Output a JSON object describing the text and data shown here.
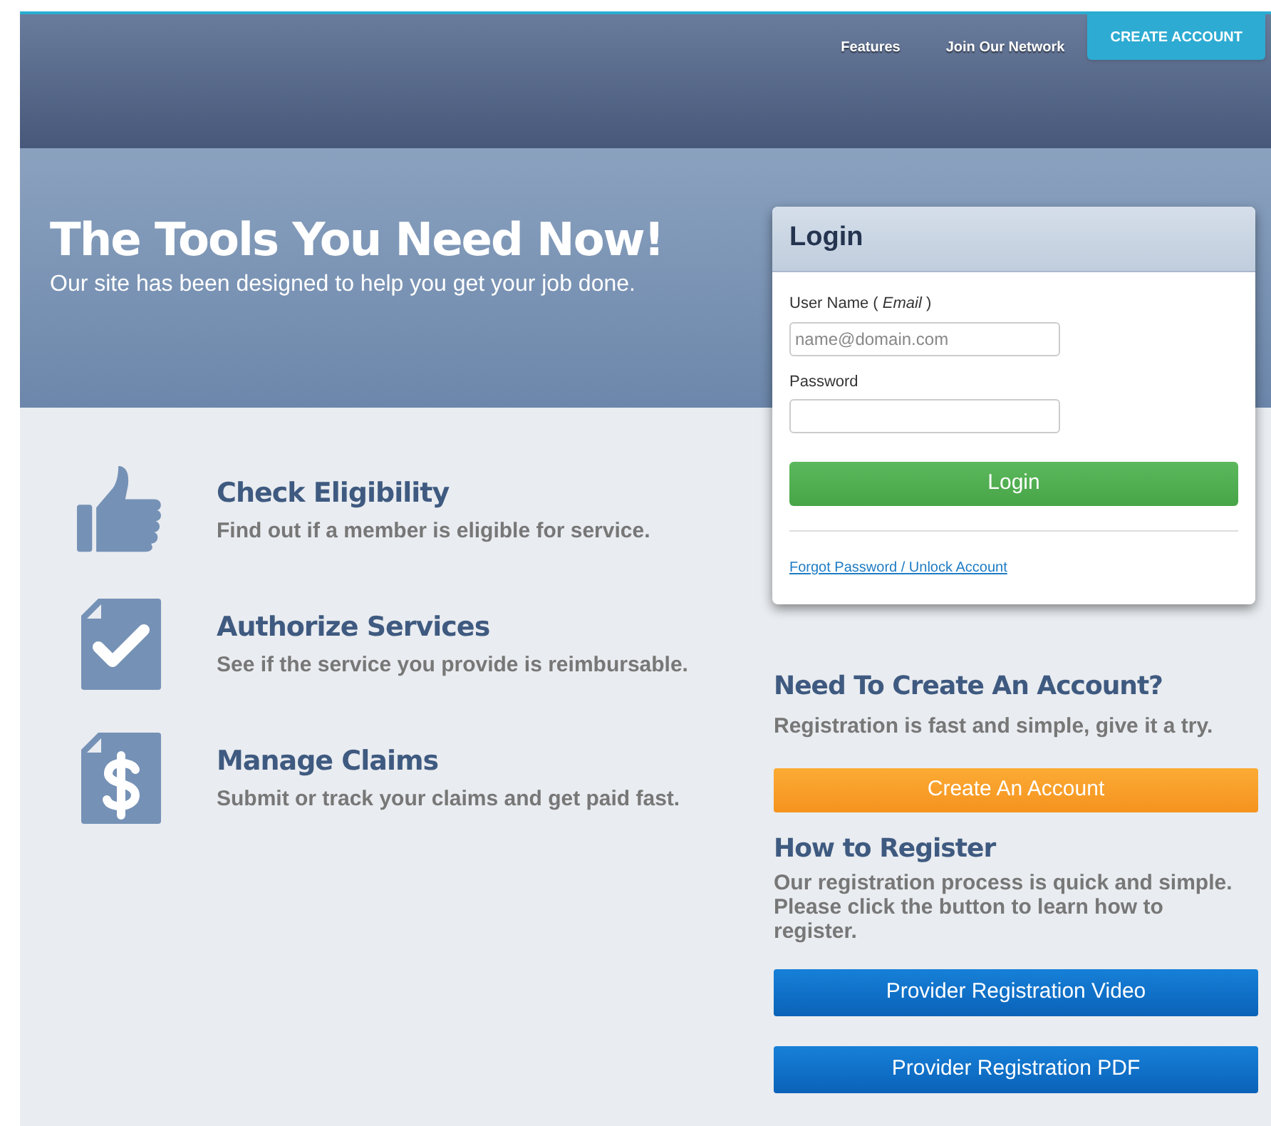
{
  "nav": {
    "links": [
      "Features",
      "Join Our Network"
    ],
    "cta": "CREATE ACCOUNT"
  },
  "hero": {
    "title": "The Tools You Need Now!",
    "subtitle": "Our site has been designed to help you get your job done."
  },
  "features": [
    {
      "kind": "thumb",
      "title": "Check Eligibility",
      "text": "Find out if a member is eligible for service."
    },
    {
      "kind": "check",
      "title": "Authorize Services",
      "text": "See if the service you provide is reimbursable."
    },
    {
      "kind": "dollar",
      "title": "Manage Claims",
      "text": "Submit or track your claims and get paid fast."
    }
  ],
  "login": {
    "title": "Login",
    "username_label": "User Name  ( *Email* )",
    "username_placeholder": "name@domain.com",
    "password_label": "Password",
    "button": "Login",
    "forgot_link": "Forgot Password / Unlock Account"
  },
  "create": {
    "title": "Need To Create An Account?",
    "text": "Registration is fast and simple, give it a try.",
    "button": "Create An Account"
  },
  "register": {
    "title": "How to Register",
    "text": "Our registration process is quick and simple. Please click the button to learn how to register.",
    "buttons": [
      "Provider Registration Video",
      "Provider Registration PDF"
    ]
  }
}
